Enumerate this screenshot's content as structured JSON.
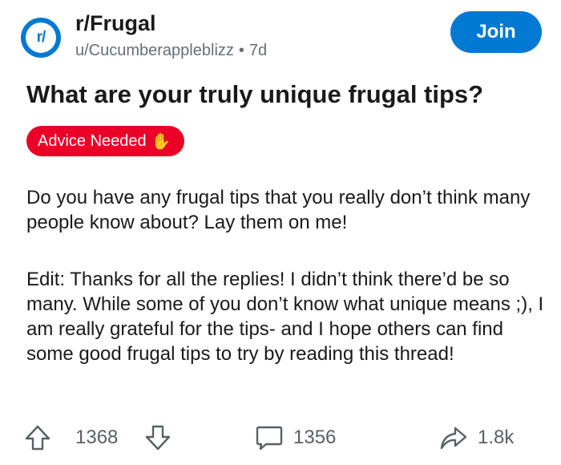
{
  "post": {
    "subreddit": "r/Frugal",
    "subreddit_icon_text": "r/",
    "author": "u/Cucumberappleblizz",
    "separator": "•",
    "age": "7d",
    "join_label": "Join",
    "title": "What are your truly unique frugal tips?",
    "flair": {
      "label": "Advice Needed",
      "emoji": "✋",
      "color": "#ea0027"
    },
    "body": [
      "Do you have any frugal tips that you really don’t think many people know about? Lay them on me!",
      "Edit: Thanks for all the replies! I didn’t think there’d be so many. While some of you don’t know what unique means ;), I am really grateful for the tips- and I hope others can find some good frugal tips to try by reading this thread!"
    ]
  },
  "actions": {
    "upvote_icon": "arrow-up-icon",
    "vote_count": "1368",
    "downvote_icon": "arrow-down-icon",
    "comment_icon": "comment-bubble-icon",
    "comment_count": "1356",
    "share_icon": "share-arrow-icon",
    "share_count": "1.8k"
  },
  "colors": {
    "accent": "#0079d3",
    "text": "#1a1a1b",
    "muted": "#6a6d70"
  }
}
